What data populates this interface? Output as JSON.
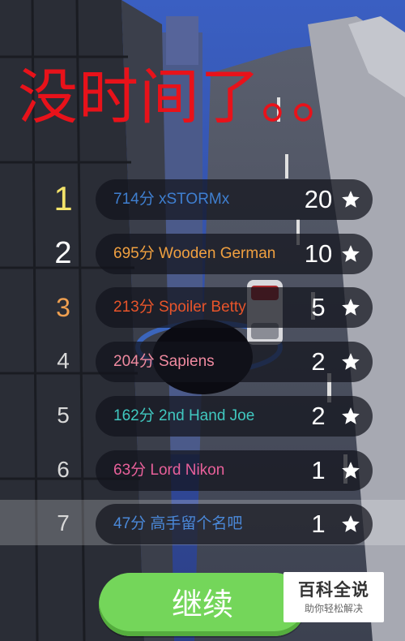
{
  "game": {
    "title": "没时间了。。",
    "continue_label": "继续"
  },
  "leaderboard": {
    "rows": [
      {
        "rank": "1",
        "score": "714分",
        "name": "xSTORMx",
        "stars": "20",
        "rank_color": "#f3e36a",
        "text_color": "#3f7fd0"
      },
      {
        "rank": "2",
        "score": "695分",
        "name": "Wooden German",
        "stars": "10",
        "rank_color": "#ffffff",
        "text_color": "#f0a040"
      },
      {
        "rank": "3",
        "score": "213分",
        "name": "Spoiler Betty",
        "stars": "5",
        "rank_color": "#f0a050",
        "text_color": "#e8542a"
      },
      {
        "rank": "4",
        "score": "204分",
        "name": "Sapiens",
        "stars": "2",
        "rank_color": "#d8d8d8",
        "text_color": "#f08aa0"
      },
      {
        "rank": "5",
        "score": "162分",
        "name": "2nd Hand Joe",
        "stars": "2",
        "rank_color": "#d8d8d8",
        "text_color": "#40c8c0"
      },
      {
        "rank": "6",
        "score": "63分",
        "name": "Lord Nikon",
        "stars": "1",
        "rank_color": "#d8d8d8",
        "text_color": "#e8609a"
      },
      {
        "rank": "7",
        "score": "47分",
        "name": "高手留个名吧",
        "stars": "1",
        "rank_color": "#d8d8d8",
        "text_color": "#4a88d8"
      }
    ]
  },
  "watermark": {
    "main": "百科全说",
    "sub": "助你轻松解决"
  },
  "icons": {
    "star": "star-icon"
  }
}
